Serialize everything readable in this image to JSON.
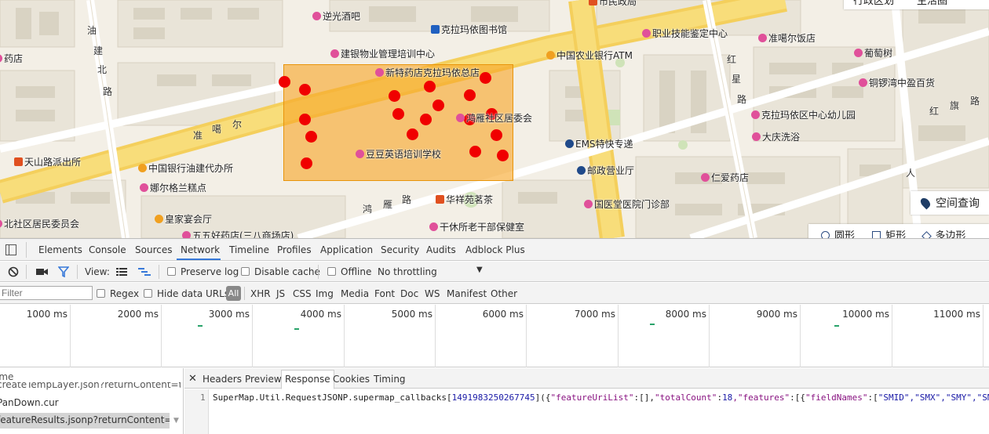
{
  "map": {
    "pois": [
      {
        "id": "jiuba",
        "label": "逆光酒吧",
        "color": "pink"
      },
      {
        "id": "library",
        "label": "克拉玛依图书馆",
        "color": "blue"
      },
      {
        "id": "shimin",
        "label": "市民政局",
        "color": "red"
      },
      {
        "id": "zhiye",
        "label": "职业技能鉴定中心",
        "color": "pink"
      },
      {
        "id": "zhungeer-hotel",
        "label": "准噶尔饭店",
        "color": "pink"
      },
      {
        "id": "jianyin",
        "label": "建银物业管理培训中心",
        "color": "pink"
      },
      {
        "id": "nongye",
        "label": "中国农业银行ATM",
        "color": "orange"
      },
      {
        "id": "putao",
        "label": "葡萄树",
        "color": "pink"
      },
      {
        "id": "yaodian",
        "label": "药店",
        "color": "pink"
      },
      {
        "id": "xinte",
        "label": "新特药店克拉玛依总店",
        "color": "pink"
      },
      {
        "id": "tongluowan",
        "label": "铜锣湾中盈百货",
        "color": "pink"
      },
      {
        "id": "honghu",
        "label": "鸿雁社区居委会",
        "color": "pink"
      },
      {
        "id": "kindergarten",
        "label": "克拉玛依区中心幼儿园",
        "color": "pink"
      },
      {
        "id": "daqing",
        "label": "大庆洗浴",
        "color": "pink"
      },
      {
        "id": "ems",
        "label": "EMS特快专递",
        "color": "navy"
      },
      {
        "id": "tianshan",
        "label": "天山路派出所",
        "color": "red"
      },
      {
        "id": "doudou",
        "label": "豆豆英语培训学校",
        "color": "pink"
      },
      {
        "id": "zhongyin",
        "label": "中国银行油建代办所",
        "color": "orange"
      },
      {
        "id": "youzheng",
        "label": "邮政营业厅",
        "color": "navy"
      },
      {
        "id": "renai",
        "label": "仁爱药店",
        "color": "pink"
      },
      {
        "id": "naer",
        "label": "娜尔格兰糕点",
        "color": "pink"
      },
      {
        "id": "huaxiang",
        "label": "华祥苑茗茶",
        "color": "red"
      },
      {
        "id": "guoyitang",
        "label": "国医堂医院门诊部",
        "color": "pink"
      },
      {
        "id": "huangjia",
        "label": "皇家宴会厅",
        "color": "orange"
      },
      {
        "id": "ganxiu",
        "label": "干休所老干部保健室",
        "color": "pink"
      },
      {
        "id": "jumin",
        "label": "北社区居民委员会",
        "color": "pink"
      },
      {
        "id": "bottom-cut",
        "label": "五五好药店(三八商场店)",
        "color": "pink"
      }
    ],
    "roads": {
      "youjianbei": "油建北路",
      "zhungeer": "准噶尔路",
      "hongyan": "鸿雁路",
      "hong": "红星路",
      "hongqi": "红旗路",
      "ren": "人"
    },
    "spatial_query_label": "空间查询",
    "top_tools": [
      "行政区划",
      "生活圈"
    ],
    "shapes": [
      "圆形",
      "矩形",
      "多边形"
    ]
  },
  "devtools": {
    "tabs": [
      "Elements",
      "Console",
      "Sources",
      "Network",
      "Timeline",
      "Profiles",
      "Application",
      "Security",
      "Audits",
      "Adblock Plus"
    ],
    "active_tab": "Network",
    "toolbar": {
      "view_label": "View:",
      "preserve_log": "Preserve log",
      "disable_cache": "Disable cache",
      "offline": "Offline",
      "throttling": "No throttling"
    },
    "filter": {
      "placeholder": "Filter",
      "regex": "Regex",
      "hide_data_urls": "Hide data URLs",
      "types": [
        "All",
        "XHR",
        "JS",
        "CSS",
        "Img",
        "Media",
        "Font",
        "Doc",
        "WS",
        "Manifest",
        "Other"
      ]
    },
    "timeline_ticks": [
      "1000 ms",
      "2000 ms",
      "3000 ms",
      "4000 ms",
      "5000 ms",
      "6000 ms",
      "7000 ms",
      "8000 ms",
      "9000 ms",
      "10000 ms",
      "11000 ms"
    ],
    "requests": {
      "header": "Name",
      "rows": [
        "createTempLayer.json?returnContent=true&...",
        "PanDown.cur",
        "featureResults.jsonp?returnContent=true&..."
      ]
    },
    "detail_tabs": [
      "Headers",
      "Preview",
      "Response",
      "Cookies",
      "Timing"
    ],
    "active_detail_tab": "Response",
    "response": {
      "line_number": "1",
      "callback": "SuperMap.Util.RequestJSONP.supermap_callbacks[",
      "callback_id": "1491983250267745",
      "body_open": "]({",
      "k_feature_uri": "\"featureUriList\"",
      "v_feature_uri": ":[],",
      "k_total": "\"totalCount\"",
      "v_total": "18",
      "k_features": ",\"features\"",
      "v_features": ":[{",
      "k_fieldnames": "\"fieldNames\"",
      "v_fieldnames": ":[",
      "f1": "\"SMID\"",
      "f2": ",\"SMX\"",
      "f3": ",\"SMY\"",
      "f4": ",\"SM"
    }
  }
}
